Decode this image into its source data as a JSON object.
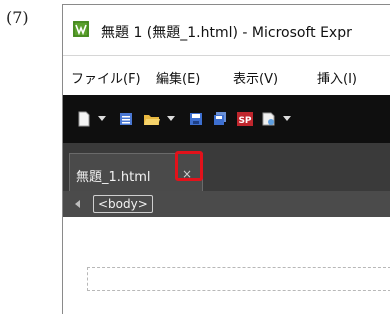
{
  "step_label": "(7)",
  "window": {
    "title": "無題 1 (無題_1.html) - Microsoft Expr",
    "app_icon": "expression-web-icon"
  },
  "menu": {
    "items": [
      "ファイル(F)",
      "編集(E)",
      "表示(V)",
      "挿入(I)"
    ]
  },
  "toolbar": {
    "icons": [
      "new-page-icon",
      "dropdown-arrow-icon",
      "list-icon",
      "open-folder-icon",
      "dropdown-arrow-icon",
      "save-icon",
      "save-all-icon",
      "sharepoint-icon",
      "preview-icon"
    ],
    "sp_label": "SP"
  },
  "document_tab": {
    "label": "無題_1.html",
    "close_glyph": "×",
    "highlight_color": "#e2121b"
  },
  "tag_selector": {
    "tag": "<body>"
  }
}
